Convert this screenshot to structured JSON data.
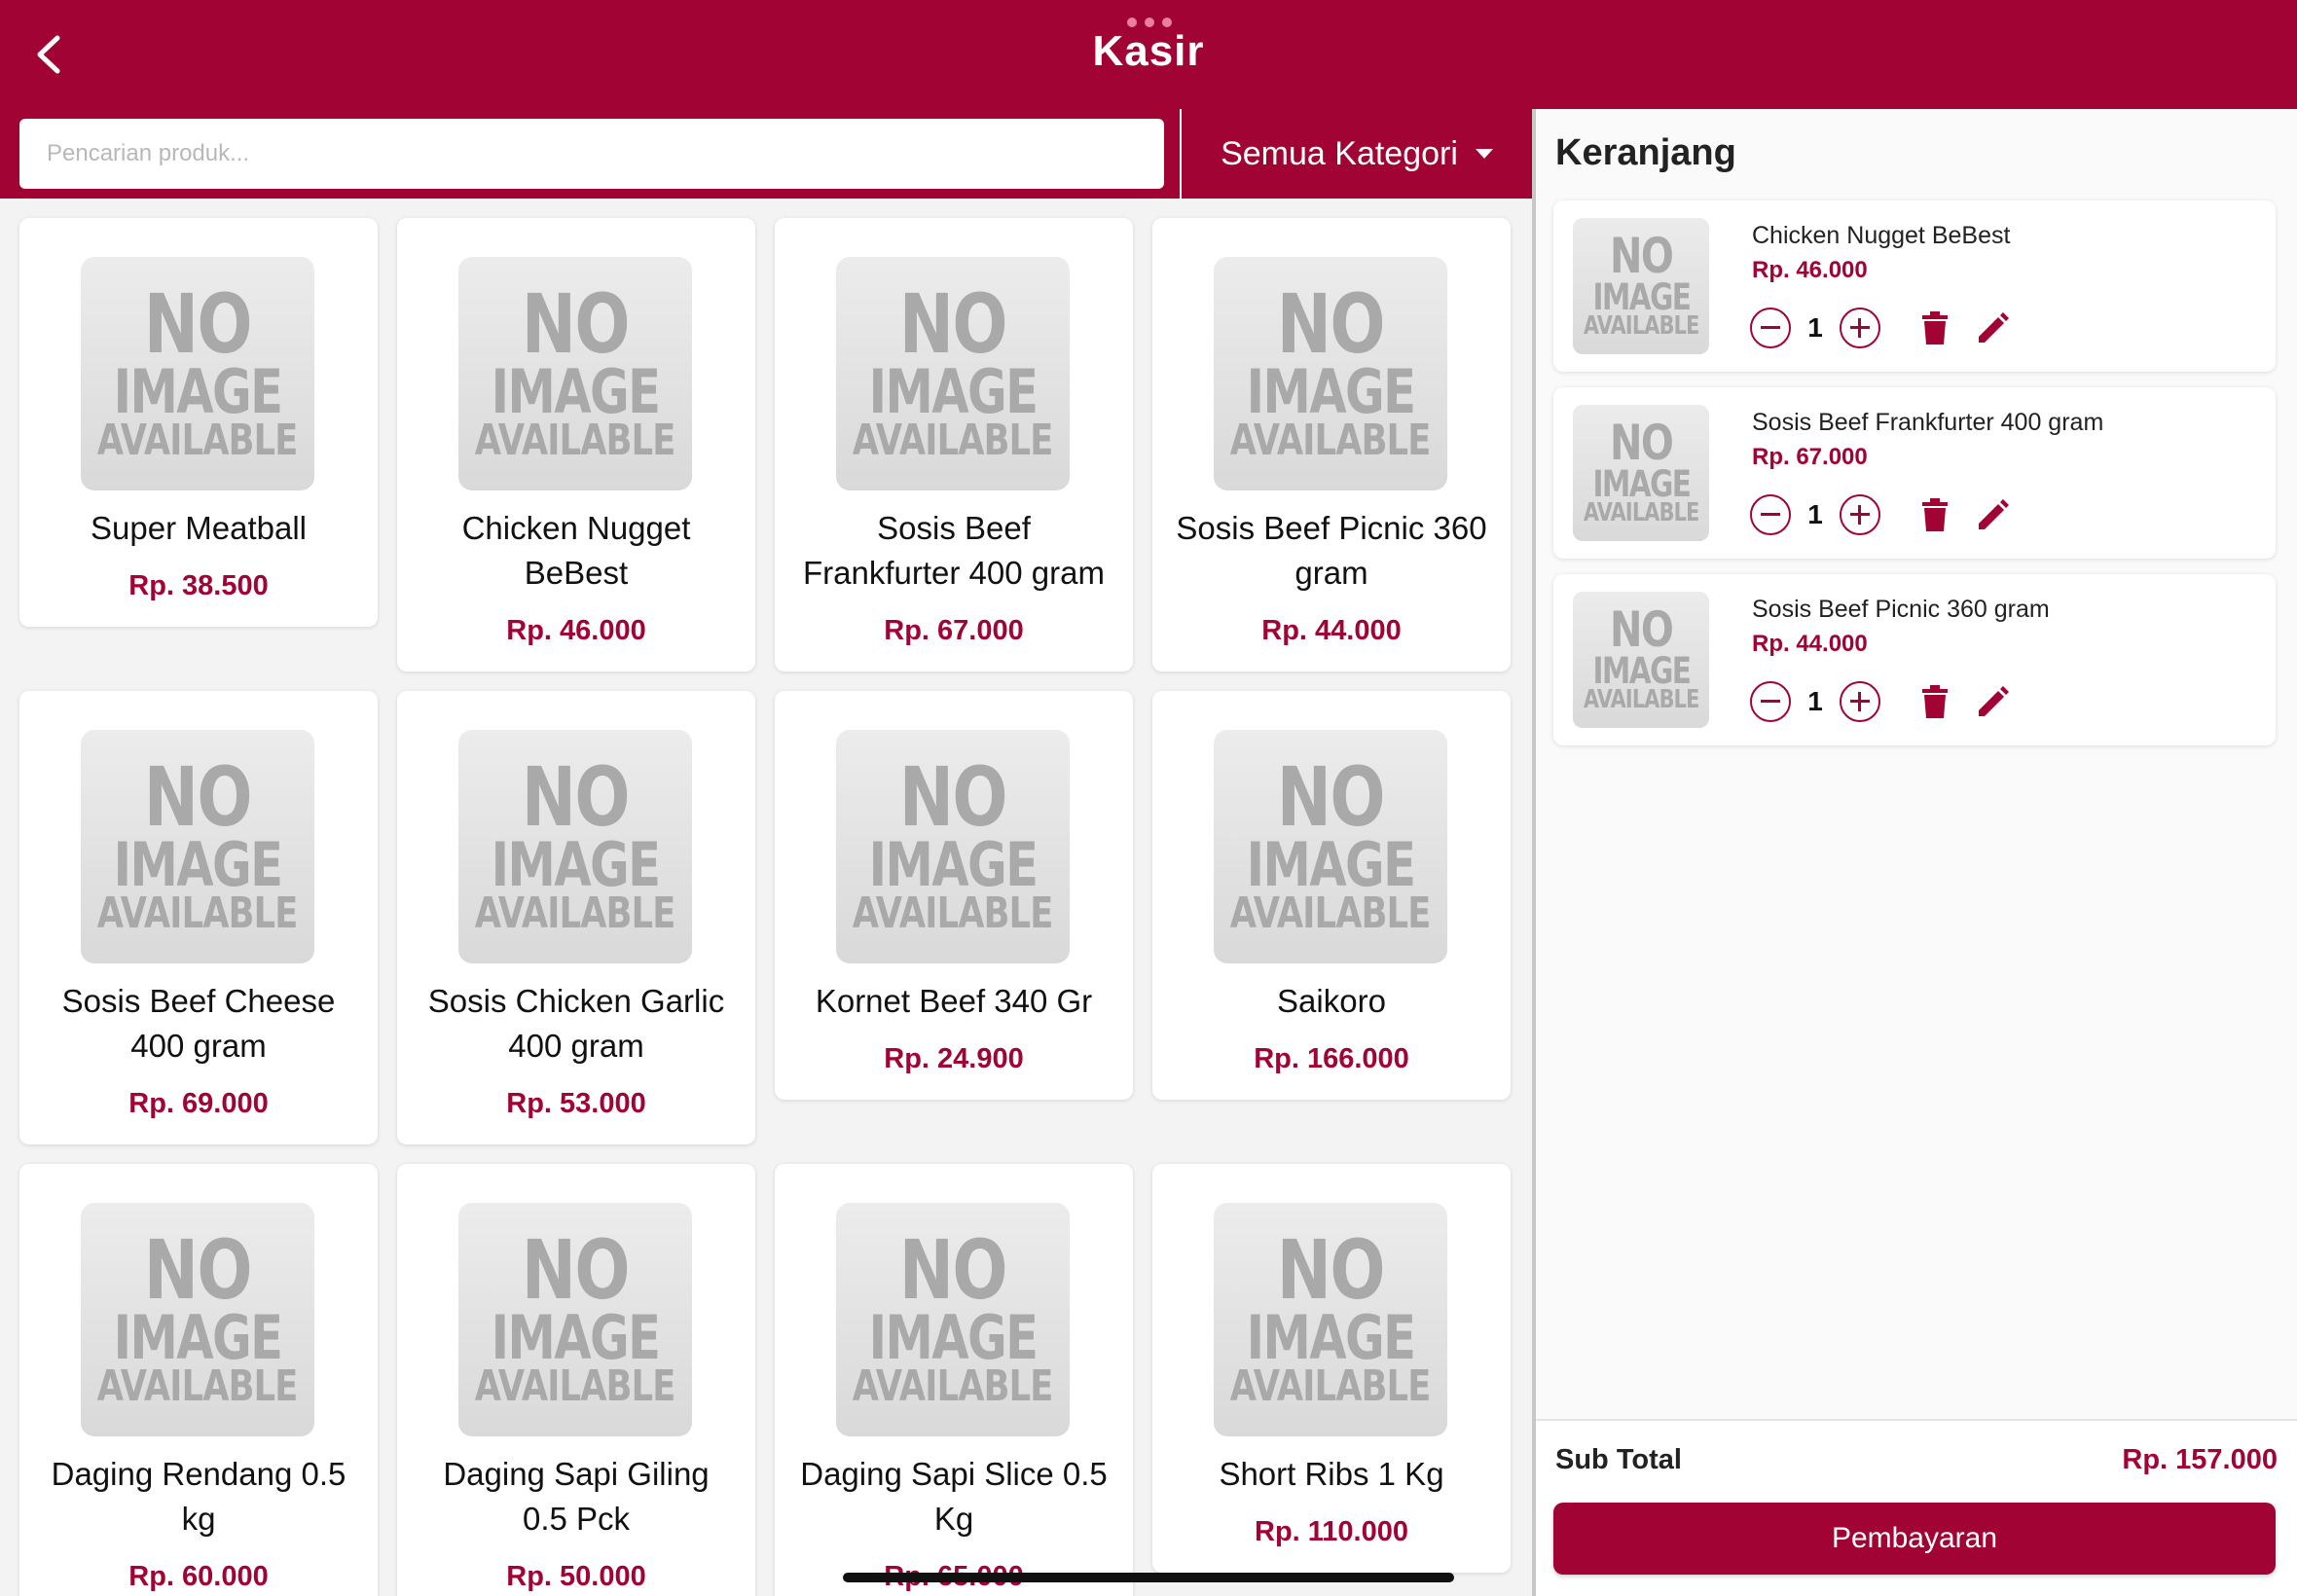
{
  "header": {
    "title": "Kasir",
    "back_icon": "chevron-left-icon",
    "color": "#a10434"
  },
  "search": {
    "placeholder": "Pencarian produk...",
    "value": ""
  },
  "category": {
    "selected": "Semua Kategori"
  },
  "products": [
    {
      "name": "Super Meatball",
      "price": "Rp. 38.500",
      "image": "no-image-available"
    },
    {
      "name": "Chicken Nugget BeBest",
      "price": "Rp. 46.000",
      "image": "no-image-available"
    },
    {
      "name": "Sosis Beef Frankfurter 400 gram",
      "price": "Rp. 67.000",
      "image": "no-image-available"
    },
    {
      "name": "Sosis Beef Picnic 360 gram",
      "price": "Rp. 44.000",
      "image": "no-image-available"
    },
    {
      "name": "Sosis Beef Cheese 400 gram",
      "price": "Rp. 69.000",
      "image": "no-image-available"
    },
    {
      "name": "Sosis Chicken Garlic 400 gram",
      "price": "Rp. 53.000",
      "image": "no-image-available"
    },
    {
      "name": "Kornet Beef 340 Gr",
      "price": "Rp. 24.900",
      "image": "no-image-available"
    },
    {
      "name": "Saikoro",
      "price": "Rp. 166.000",
      "image": "no-image-available"
    },
    {
      "name": "Daging Rendang 0.5 kg",
      "price": "Rp. 60.000",
      "image": "no-image-available"
    },
    {
      "name": "Daging Sapi Giling 0.5 Pck",
      "price": "Rp. 50.000",
      "image": "no-image-available"
    },
    {
      "name": "Daging Sapi Slice 0.5 Kg",
      "price": "Rp. 65.000",
      "image": "no-image-available"
    },
    {
      "name": "Short Ribs 1 Kg",
      "price": "Rp. 110.000",
      "image": "no-image-available"
    }
  ],
  "no_image": {
    "line1": "NO",
    "line2": "IMAGE",
    "line3": "AVAILABLE"
  },
  "cart": {
    "title": "Keranjang",
    "items": [
      {
        "name": "Chicken Nugget BeBest",
        "price": "Rp. 46.000",
        "qty": "1"
      },
      {
        "name": "Sosis Beef Frankfurter 400 gram",
        "price": "Rp. 67.000",
        "qty": "1"
      },
      {
        "name": "Sosis Beef Picnic 360 gram",
        "price": "Rp. 44.000",
        "qty": "1"
      }
    ],
    "subtotal_label": "Sub Total",
    "subtotal_value": "Rp. 157.000",
    "pay_label": "Pembayaran"
  },
  "icons": {
    "back": "chevron-left-icon",
    "dropdown": "caret-down-icon",
    "minus": "minus-circle-icon",
    "plus": "plus-circle-icon",
    "delete": "trash-icon",
    "edit": "pencil-icon"
  }
}
